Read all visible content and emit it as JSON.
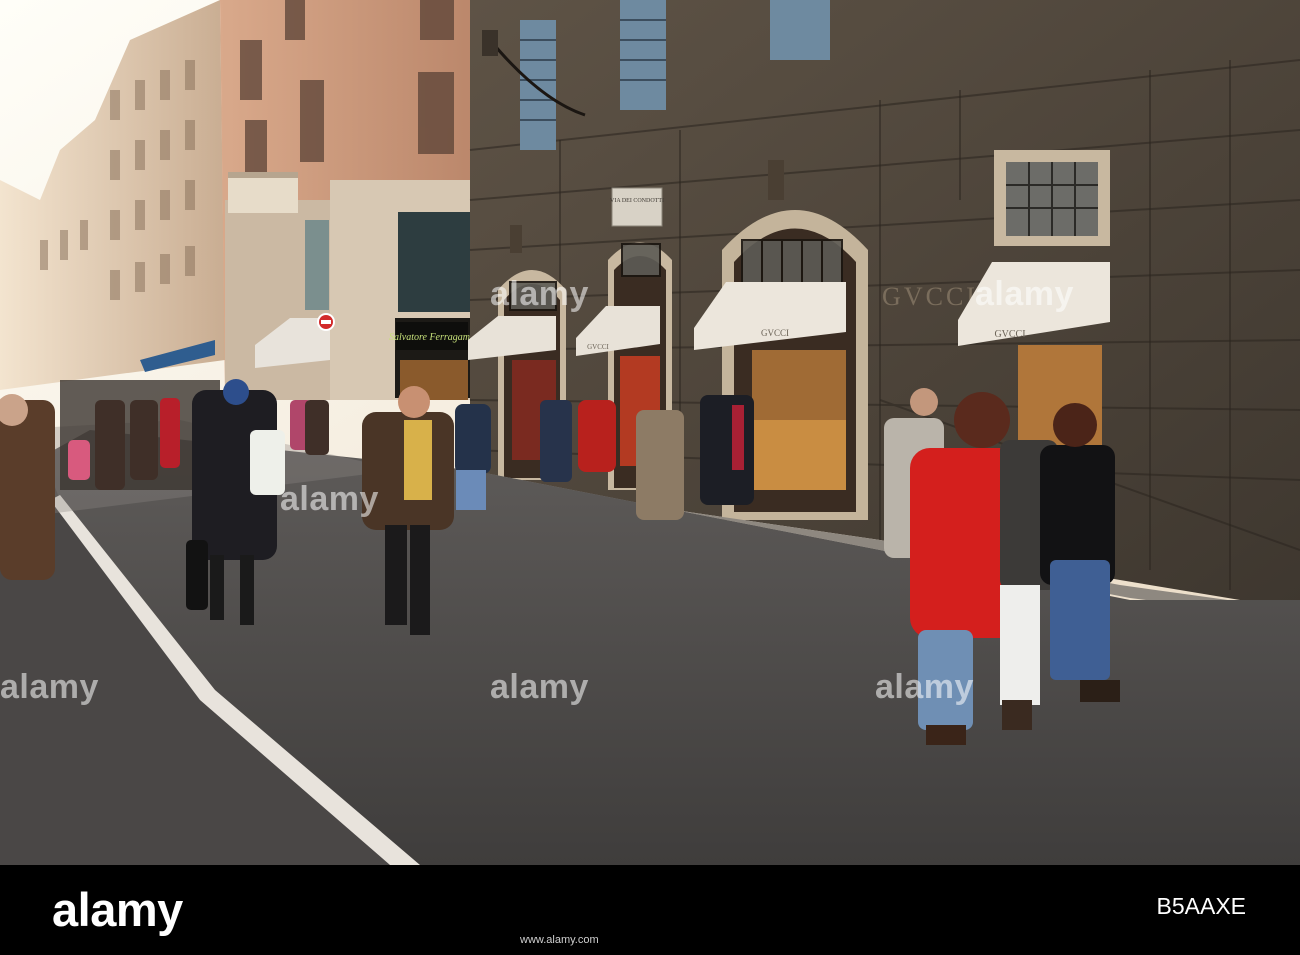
{
  "image": {
    "description_alt": "",
    "signs": {
      "street_sign": "VIA DEI CONDOTTI",
      "ferragamo": "Salvatore Ferragamo",
      "gucci_1": "GVCCI",
      "gucci_2": "GVCCI",
      "gucci_3": "GVCCI",
      "gucci_facade": "GVCCI"
    }
  },
  "watermark": {
    "text": "alamy"
  },
  "footer": {
    "brand": "alamy",
    "image_code": "B5AAXE",
    "reference": "www.alamy.com"
  }
}
